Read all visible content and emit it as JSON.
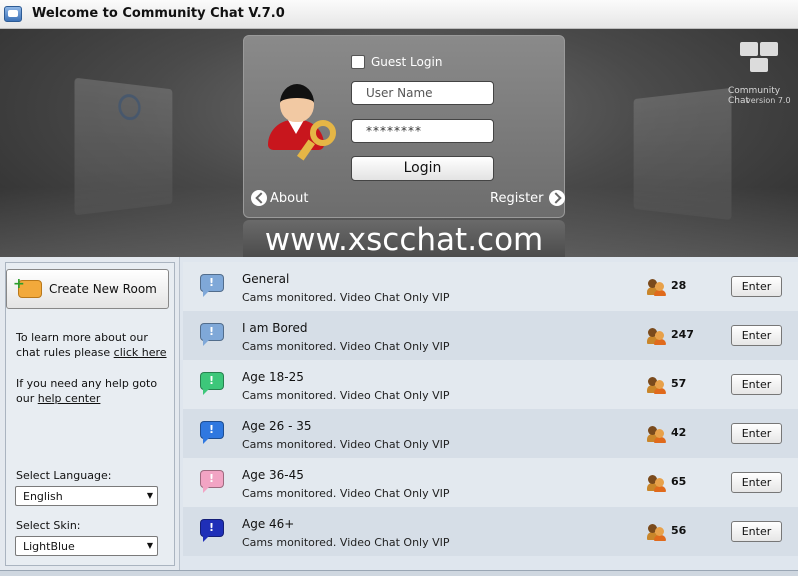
{
  "window": {
    "title": "Welcome to Community Chat V.7.0"
  },
  "brand": {
    "name": "Community Chat",
    "version": "version 7.0",
    "domain": "www.xscchat.com"
  },
  "login": {
    "guest_label": "Guest Login",
    "username_placeholder": "User Name",
    "password_mask": "********",
    "login_label": "Login",
    "about_label": "About",
    "register_label": "Register"
  },
  "sidebar": {
    "create_room_label": "Create New Room",
    "rules_text": "To learn more about our chat rules please ",
    "rules_link": "click here",
    "help_text": "If you need any help goto our ",
    "help_link": "help center",
    "language_label": "Select Language:",
    "language_value": "English",
    "skin_label": "Select Skin:",
    "skin_value": "LightBlue"
  },
  "rooms": [
    {
      "name": "General",
      "description": "Cams monitored. Video Chat Only VIP",
      "users": "28",
      "color": "#7fa8d8",
      "enter_label": "Enter"
    },
    {
      "name": "I am Bored",
      "description": "Cams monitored. Video Chat Only VIP",
      "users": "247",
      "color": "#7fa8d8",
      "enter_label": "Enter"
    },
    {
      "name": "Age 18-25",
      "description": "Cams monitored. Video Chat Only VIP",
      "users": "57",
      "color": "#3dc77a",
      "enter_label": "Enter"
    },
    {
      "name": "Age 26 - 35",
      "description": "Cams monitored. Video Chat Only VIP",
      "users": "42",
      "color": "#2f78e0",
      "enter_label": "Enter"
    },
    {
      "name": "Age 36-45",
      "description": "Cams monitored. Video Chat Only VIP",
      "users": "65",
      "color": "#f2a4c4",
      "enter_label": "Enter"
    },
    {
      "name": "Age 46+",
      "description": "Cams monitored. Video Chat Only VIP",
      "users": "56",
      "color": "#1f2fb8",
      "enter_label": "Enter"
    }
  ]
}
